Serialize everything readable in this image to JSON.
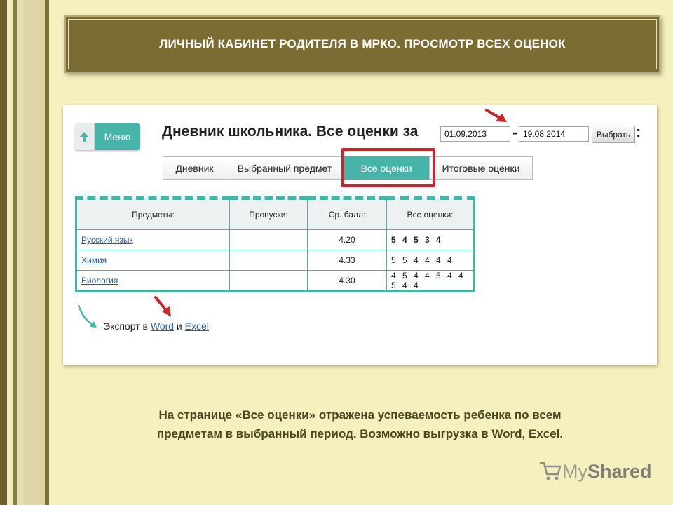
{
  "banner": {
    "title": "ЛИЧНЫЙ КАБИНЕТ РОДИТЕЛЯ  В МРКО. ПРОСМОТР ВСЕХ ОЦЕНОК"
  },
  "screen": {
    "menu_label": "Меню",
    "heading": "Дневник школьника. Все оценки за",
    "date_from": "01.09.2013",
    "date_to": "19.08.2014",
    "dash": "-",
    "colon": ":",
    "select_label": "Выбрать",
    "tabs": [
      {
        "label": "Дневник"
      },
      {
        "label": "Выбранный предмет"
      },
      {
        "label": "Все оценки",
        "active": true
      },
      {
        "label": "Итоговые оценки"
      }
    ],
    "table": {
      "headers": [
        "Предметы:",
        "Пропуски:",
        "Ср. балл:",
        "Все оценки:"
      ],
      "rows": [
        {
          "subject": "Русский язык",
          "absences": "",
          "avg": "4.20",
          "grades": "5 4 5 3 4"
        },
        {
          "subject": "Химия",
          "absences": "",
          "avg": "4.33",
          "grades": "5 5 4 4 4 4"
        },
        {
          "subject": "Биология",
          "absences": "",
          "avg": "4.30",
          "grades": "4 5 4 4 5 4 4 5 4 4"
        }
      ]
    },
    "export": {
      "prefix": "Экспорт в",
      "word": "Word",
      "and": "и",
      "excel": "Excel"
    }
  },
  "caption": {
    "line1": "На странице «Все оценки» отражена успеваемость ребенка по всем",
    "line2": "предметам в выбранный период. Возможно выгрузка в Word, Excel."
  },
  "logo": {
    "text_a": "My",
    "text_b": "Shared"
  },
  "colors": {
    "banner": "#7b6c33",
    "accent": "#47b4aa",
    "highlight": "#c8262b",
    "background": "#f6efbe"
  }
}
